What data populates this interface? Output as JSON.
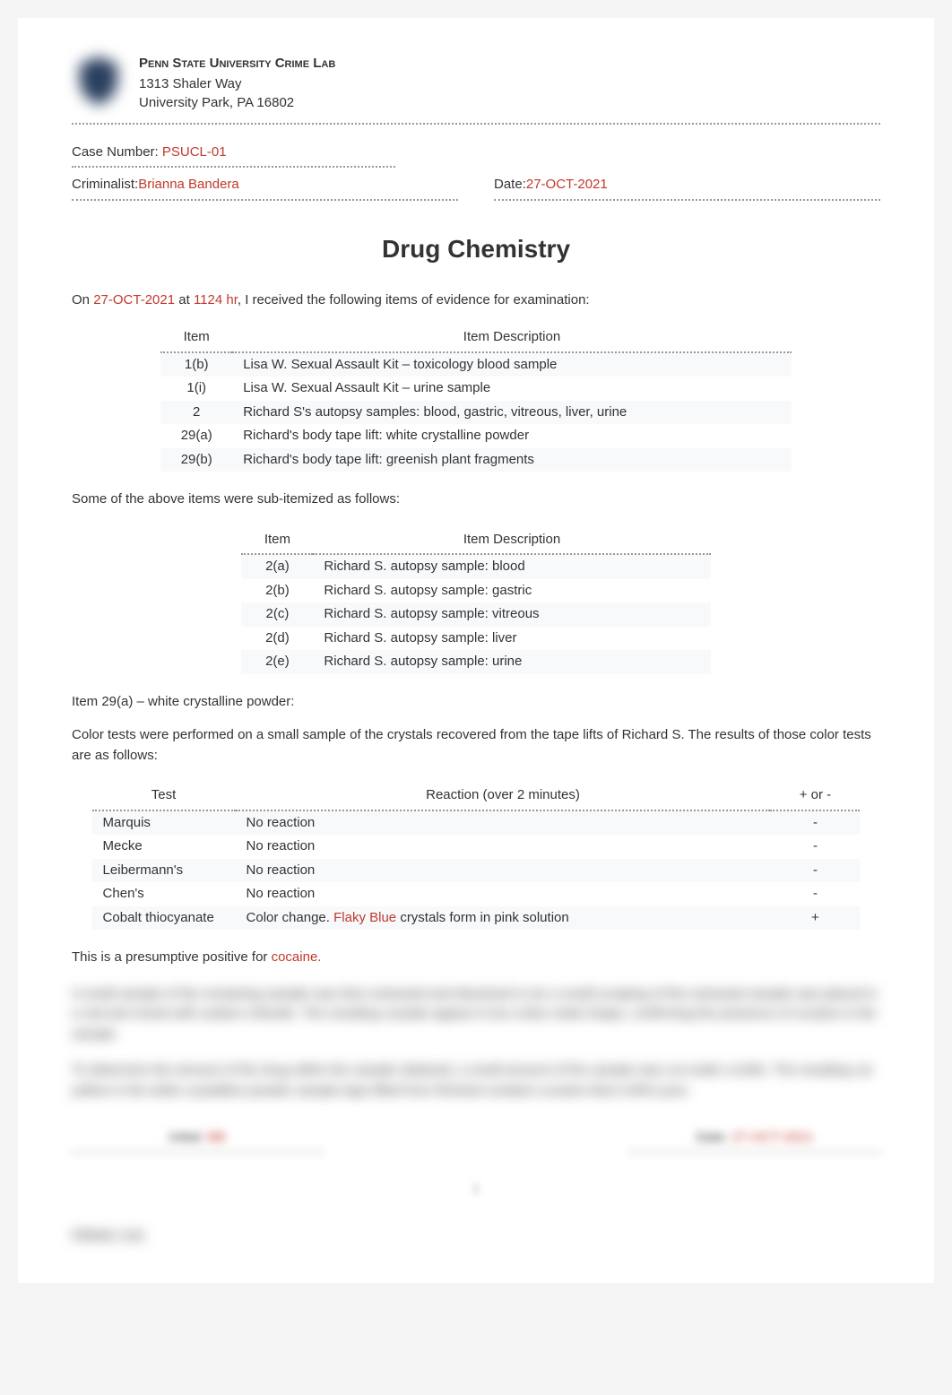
{
  "header": {
    "lab_name": "Penn State University Crime Lab",
    "addr1": "1313 Shaler Way",
    "addr2": "University Park, PA 16802"
  },
  "meta": {
    "case_label": "Case Number: ",
    "case_value": "PSUCL-01",
    "criminalist_label": "Criminalist: ",
    "criminalist_value": "Brianna Bandera",
    "date_label": "Date: ",
    "date_value": "27-OCT-2021"
  },
  "title": "Drug Chemistry",
  "intro": {
    "pre": "On ",
    "date": "27-OCT-2021",
    "mid": " at ",
    "time": "1124 hr",
    "post": ", I received the following items of evidence for examination:"
  },
  "items_header": {
    "c1": "Item",
    "c2": "Item Description"
  },
  "items": [
    {
      "id": "1(b)",
      "desc": "Lisa W. Sexual Assault Kit – toxicology blood sample"
    },
    {
      "id": "1(i)",
      "desc": "Lisa W. Sexual Assault Kit – urine sample"
    },
    {
      "id": "2",
      "desc": "Richard S's autopsy samples: blood, gastric, vitreous, liver, urine"
    },
    {
      "id": "29(a)",
      "desc": "Richard's body tape lift: white crystalline powder"
    },
    {
      "id": "29(b)",
      "desc": "Richard's body tape lift: greenish plant fragments"
    }
  ],
  "sub_intro": "Some of the above items were sub-itemized as follows:",
  "sub_header": {
    "c1": "Item",
    "c2": "Item Description"
  },
  "sub_items": [
    {
      "id": "2(a)",
      "desc": "Richard S. autopsy sample: blood"
    },
    {
      "id": "2(b)",
      "desc": "Richard S. autopsy sample: gastric"
    },
    {
      "id": "2(c)",
      "desc": "Richard S. autopsy sample: vitreous"
    },
    {
      "id": "2(d)",
      "desc": "Richard S. autopsy sample: liver"
    },
    {
      "id": "2(e)",
      "desc": "Richard S. autopsy sample: urine"
    }
  ],
  "section29a": "Item 29(a) – white crystalline powder:",
  "color_intro": "Color tests were performed on a small sample of the crystals recovered from the tape lifts of Richard S. The results of those color tests are as follows:",
  "color_header": {
    "c1": "Test",
    "c2": "Reaction (over 2 minutes)",
    "c3": "+ or -"
  },
  "color_tests": [
    {
      "test": "Marquis",
      "reaction_pre": "No reaction",
      "reaction_red": "",
      "reaction_post": "",
      "result": "-"
    },
    {
      "test": "Mecke",
      "reaction_pre": "No reaction",
      "reaction_red": "",
      "reaction_post": "",
      "result": "-"
    },
    {
      "test": "Leibermann's",
      "reaction_pre": "No reaction",
      "reaction_red": "",
      "reaction_post": "",
      "result": "-"
    },
    {
      "test": "Chen's",
      "reaction_pre": "No reaction",
      "reaction_red": "",
      "reaction_post": "",
      "result": "-"
    },
    {
      "test": "Cobalt thiocyanate",
      "reaction_pre": "Color change. ",
      "reaction_red": "Flaky Blue ",
      "reaction_post": "crystals form in pink solution",
      "result": "+"
    }
  ],
  "presumptive": {
    "pre": "This is a presumptive positive for ",
    "drug": "cocaine."
  },
  "blurred_p1": "A small sample of the remaining sample was then extracted and dissolved in etc a small scraping of the extracted sample was placed in a vial and mixed with sodium chloride. The resulting crystals appear to be a blue violet shape, confirming the presence of cocaine in the sample.",
  "blurred_p2": "To determine the amount of the drug within the sample obtained, a small amount of the sample was cut under a knife. The resulting cut yellow in the white crystalline powder sample tape lifted from Richard contains cocaine that is 80% pure.",
  "sig": {
    "left_label": "Initial:",
    "left_val": "BB",
    "right_label": "Date:",
    "right_val": "27-OCT-2021"
  },
  "page_num": "1",
  "footer": "FRNSC 210"
}
